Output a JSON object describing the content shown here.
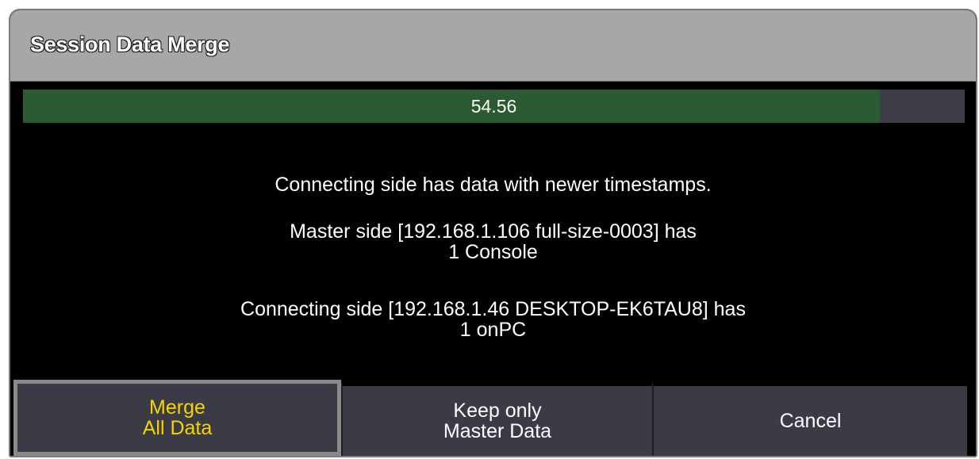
{
  "dialog": {
    "title": "Session Data Merge",
    "progress": {
      "label": "54.56",
      "percent": 91
    },
    "messages": {
      "line1": "Connecting side has data with newer timestamps.",
      "master_line1": "Master side [192.168.1.106 full-size-0003] has",
      "master_line2": "1 Console",
      "connecting_line1": "Connecting side [192.168.1.46 DESKTOP-EK6TAU8] has",
      "connecting_line2": "1 onPC"
    },
    "buttons": {
      "merge_line1": "Merge",
      "merge_line2": "All Data",
      "keep_line1": "Keep only",
      "keep_line2": "Master Data",
      "cancel": "Cancel"
    }
  },
  "colors": {
    "titlebar": "#a7a7a7",
    "background": "#000000",
    "progress_fill": "#2c5a33",
    "progress_track": "#3b3c46",
    "button": "#3a3b45",
    "selected_text": "#f5d400"
  }
}
